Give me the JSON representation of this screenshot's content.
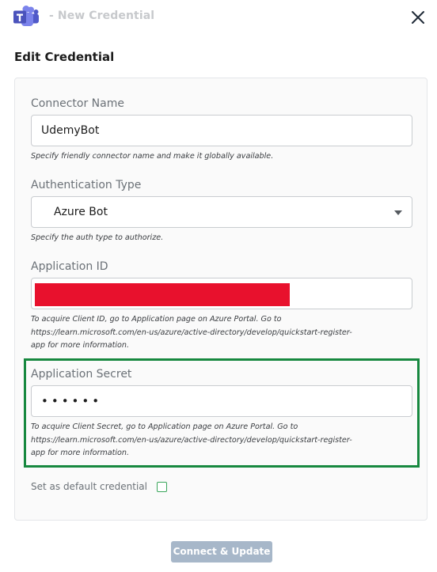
{
  "header": {
    "title": "- New Credential",
    "logo_icon": "microsoft-teams-icon",
    "close_icon": "close-icon"
  },
  "section_title": "Edit Credential",
  "form": {
    "connector_name": {
      "label": "Connector Name",
      "value": "UdemyBot",
      "help": "Specify friendly connector name and make it globally available."
    },
    "auth_type": {
      "label": "Authentication Type",
      "value": "Azure Bot",
      "help": "Specify the auth type to authorize."
    },
    "application_id": {
      "label": "Application ID",
      "value": "",
      "help_line1": "To acquire Client ID, go to Application page on Azure Portal. Go to",
      "help_line2": "https://learn.microsoft.com/en-us/azure/active-directory/develop/quickstart-register-",
      "help_line3": "app for more information."
    },
    "application_secret": {
      "label": "Application Secret",
      "value": "••••••",
      "help_line1": "To acquire Client Secret, go to Application page on Azure Portal. Go to",
      "help_line2": "https://learn.microsoft.com/en-us/azure/active-directory/develop/quickstart-register-",
      "help_line3": "app for more information."
    },
    "default_credential": {
      "label": "Set as default credential",
      "checked": false
    }
  },
  "actions": {
    "connect_label": "Connect & Update"
  },
  "colors": {
    "redaction": "#e8112d",
    "highlight_border": "#17883f",
    "button_disabled": "#a7b7c9",
    "checkbox_border": "#3aa65b"
  }
}
